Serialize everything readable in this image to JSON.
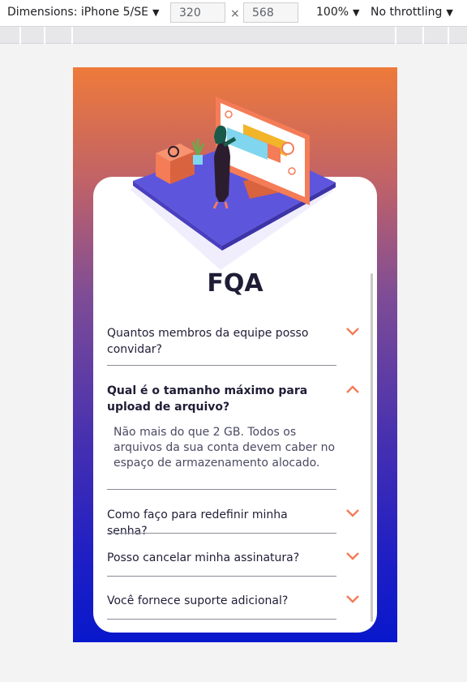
{
  "devtools": {
    "device_label": "Dimensions: iPhone 5/SE",
    "width_value": "320",
    "height_value": "568",
    "times_symbol": "×",
    "zoom_label": "100%",
    "throttle_label": "No throttling",
    "dropdown_glyph": "▼"
  },
  "page": {
    "title": "FQA",
    "accent_color": "#f47c57",
    "faq": [
      {
        "question": "Quantos membros da equipe posso convidar?",
        "answer": "",
        "open": false
      },
      {
        "question": "Qual é o tamanho máximo para upload de arquivo?",
        "answer": "Não mais do que 2 GB. Todos os arquivos da sua conta devem caber no espaço de armazenamento alocado.",
        "open": true
      },
      {
        "question": "Como faço para redefinir minha senha?",
        "answer": "",
        "open": false
      },
      {
        "question": "Posso cancelar minha assinatura?",
        "answer": "",
        "open": false
      },
      {
        "question": "Você fornece suporte adicional?",
        "answer": "",
        "open": false
      }
    ]
  }
}
